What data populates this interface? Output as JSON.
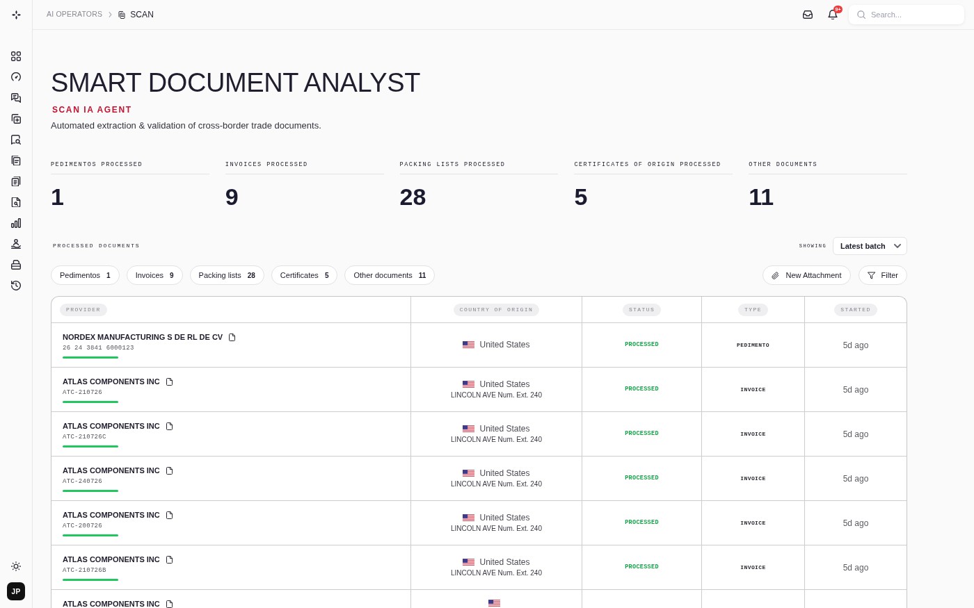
{
  "header": {
    "breadcrumb": [
      {
        "label": "AI OPERATORS",
        "current": false
      },
      {
        "label": "SCAN",
        "current": true
      }
    ],
    "notifications": "9+",
    "search": {
      "placeholder": "Search..."
    }
  },
  "user": {
    "initials": "JP"
  },
  "page": {
    "title": "SMART DOCUMENT ANALYST",
    "agent": "SCAN IA AGENT",
    "description": "Automated extraction & validation of cross-border trade documents."
  },
  "stats": [
    {
      "label": "PEDIMENTOS PROCESSED",
      "value": "1"
    },
    {
      "label": "INVOICES PROCESSED",
      "value": "9"
    },
    {
      "label": "PACKING LISTS PROCESSED",
      "value": "28"
    },
    {
      "label": "CERTIFICATES OF ORIGIN PROCESSED",
      "value": "5"
    },
    {
      "label": "OTHER DOCUMENTS",
      "value": "11"
    }
  ],
  "documents": {
    "title": "PROCESSED DOCUMENTS",
    "showing": {
      "label": "SHOWING",
      "value": "Latest batch"
    },
    "filters": [
      {
        "label": "Pedimentos",
        "count": "1"
      },
      {
        "label": "Invoices",
        "count": "9"
      },
      {
        "label": "Packing lists",
        "count": "28"
      },
      {
        "label": "Certificates",
        "count": "5"
      },
      {
        "label": "Other documents",
        "count": "11"
      }
    ],
    "actions": [
      {
        "kind": "attach",
        "label": "New Attachment"
      },
      {
        "kind": "filter",
        "label": "Filter"
      }
    ],
    "table": {
      "columns": [
        {
          "label": "PROVIDER"
        },
        {
          "label": "COUNTRY OF ORIGIN"
        },
        {
          "label": "STATUS"
        },
        {
          "label": "TYPE"
        },
        {
          "label": "STARTED"
        }
      ],
      "rows": [
        {
          "provider": "NORDEX MANUFACTURING S DE RL DE CV",
          "code": "26 24 3841 6000123",
          "country": "United States",
          "status": "PROCESSED",
          "type": "PEDIMENTO",
          "started": "5d ago"
        },
        {
          "provider": "ATLAS COMPONENTS INC",
          "code": "ATC-210726",
          "country": "United States",
          "address": "LINCOLN AVE Num. Ext. 240",
          "status": "PROCESSED",
          "type": "INVOICE",
          "started": "5d ago"
        },
        {
          "provider": "ATLAS COMPONENTS INC",
          "code": "ATC-210726C",
          "country": "United States",
          "address": "LINCOLN AVE Num. Ext. 240",
          "status": "PROCESSED",
          "type": "INVOICE",
          "started": "5d ago"
        },
        {
          "provider": "ATLAS COMPONENTS INC",
          "code": "ATC-240726",
          "country": "United States",
          "address": "LINCOLN AVE Num. Ext. 240",
          "status": "PROCESSED",
          "type": "INVOICE",
          "started": "5d ago"
        },
        {
          "provider": "ATLAS COMPONENTS INC",
          "code": "ATC-200726",
          "country": "United States",
          "address": "LINCOLN AVE Num. Ext. 240",
          "status": "PROCESSED",
          "type": "INVOICE",
          "started": "5d ago"
        },
        {
          "provider": "ATLAS COMPONENTS INC",
          "code": "ATC-210726B",
          "country": "United States",
          "address": "LINCOLN AVE Num. Ext. 240",
          "status": "PROCESSED",
          "type": "INVOICE",
          "started": "5d ago"
        },
        {
          "provider": "ATLAS COMPONENTS INC"
        }
      ]
    }
  }
}
